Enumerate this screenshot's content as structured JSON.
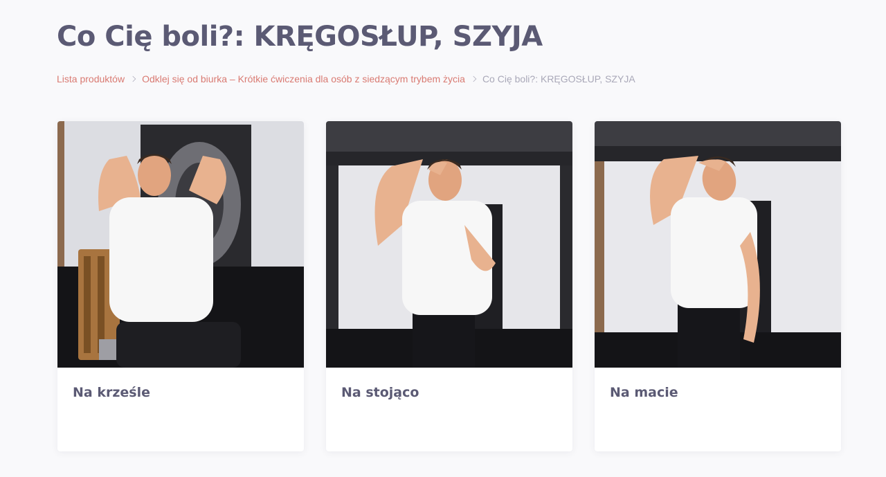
{
  "page": {
    "title": "Co Cię boli?: KRĘGOSŁUP, SZYJA"
  },
  "breadcrumb": {
    "items": [
      {
        "label": "Lista produktów"
      },
      {
        "label": "Odklej się od biurka – Krótkie ćwiczenia dla osób z siedzącym trybem życia"
      },
      {
        "label": "Co Cię boli?: KRĘGOSŁUP, SZYJA"
      }
    ]
  },
  "cards": [
    {
      "title": "Na krześle",
      "image": "man-seated-on-chair-stretching-photo"
    },
    {
      "title": "Na stojąco",
      "image": "man-standing-neck-stretch-photo"
    },
    {
      "title": "Na macie",
      "image": "man-side-bend-neck-stretch-photo"
    }
  ],
  "colors": {
    "heading": "#5b5a74",
    "link": "#d97a72",
    "muted": "#a9a8b8",
    "background": "#f9f9fb"
  }
}
